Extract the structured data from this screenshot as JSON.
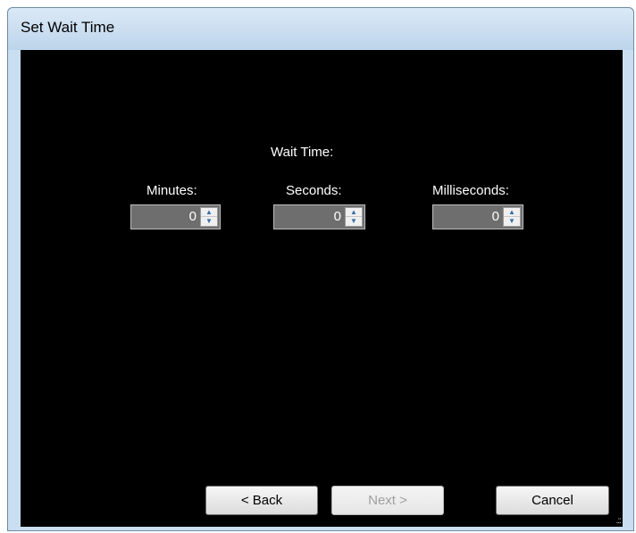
{
  "window": {
    "title": "Set Wait Time"
  },
  "form": {
    "heading": "Wait Time:",
    "minutes": {
      "label": "Minutes:",
      "value": "0"
    },
    "seconds": {
      "label": "Seconds:",
      "value": "0"
    },
    "milliseconds": {
      "label": "Milliseconds:",
      "value": "0"
    }
  },
  "buttons": {
    "back": "< Back",
    "next": "Next >",
    "cancel": "Cancel"
  },
  "icons": {
    "spin_up": "triangle-up",
    "spin_down": "triangle-down",
    "resize_grip": "size-grip"
  },
  "colors": {
    "client_background": "#000000",
    "title_bar": "#c9dff1",
    "spin_field": "#6e6e6e"
  }
}
